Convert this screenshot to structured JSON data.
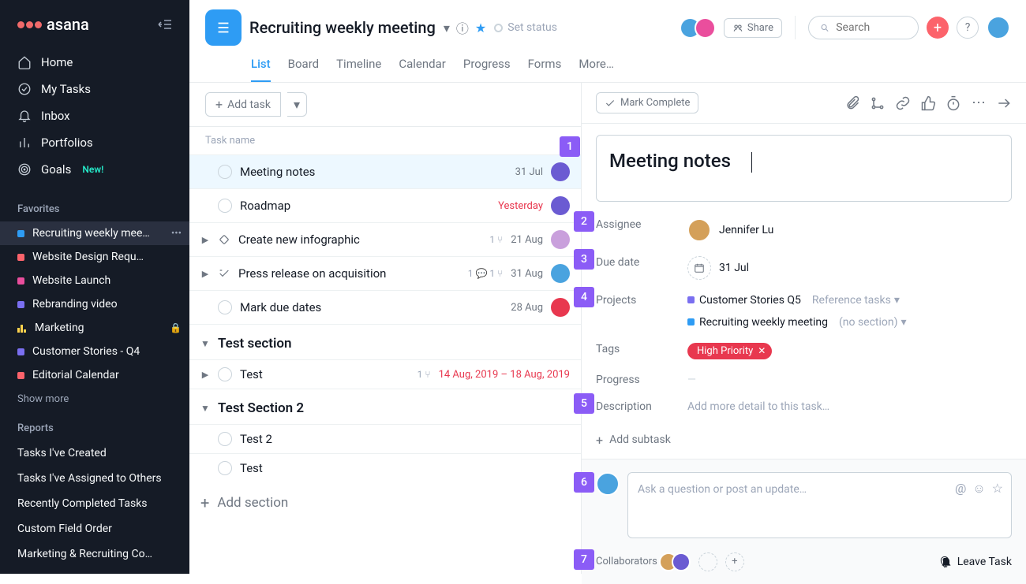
{
  "brand": "asana",
  "nav": [
    {
      "icon": "home",
      "label": "Home"
    },
    {
      "icon": "check",
      "label": "My Tasks"
    },
    {
      "icon": "bell",
      "label": "Inbox"
    },
    {
      "icon": "bars",
      "label": "Portfolios"
    },
    {
      "icon": "target",
      "label": "Goals",
      "badge": "New!"
    }
  ],
  "sections": {
    "favorites_header": "Favorites",
    "reports_header": "Reports",
    "show_more": "Show more"
  },
  "favorites": [
    {
      "color": "#2e9cf4",
      "label": "Recruiting weekly mee…",
      "active": true,
      "dots": true
    },
    {
      "color": "#fc636b",
      "label": "Website Design Requ…"
    },
    {
      "color": "#ea4e9d",
      "label": "Website Launch"
    },
    {
      "color": "#7a6ff0",
      "label": "Rebranding video"
    },
    {
      "bars": true,
      "label": "Marketing",
      "lock": true
    },
    {
      "color": "#7a6ff0",
      "label": "Customer Stories - Q4"
    },
    {
      "color": "#fc636b",
      "label": "Editorial Calendar"
    }
  ],
  "reports": [
    "Tasks I've Created",
    "Tasks I've Assigned to Others",
    "Recently Completed Tasks",
    "Custom Field Order",
    "Marketing & Recruiting Co…"
  ],
  "project": {
    "title": "Recruiting weekly meeting",
    "set_status": "Set status",
    "share": "Share",
    "search_placeholder": "Search"
  },
  "tabs": [
    "List",
    "Board",
    "Timeline",
    "Calendar",
    "Progress",
    "Forms",
    "More…"
  ],
  "active_tab": "List",
  "toolbar": {
    "add_task": "Add task"
  },
  "columns": {
    "task_name": "Task name"
  },
  "tasks_top": [
    {
      "name": "Meeting notes",
      "due": "31 Jul",
      "avatar": "#6b5bd2",
      "selected": true
    },
    {
      "name": "Roadmap",
      "due": "Yesterday",
      "due_red": true,
      "avatar": "#6b5bd2"
    },
    {
      "name": "Create new infographic",
      "due": "21 Aug",
      "avatar": "#c9a0dc",
      "caret": true,
      "milestone": true,
      "meta": "1 ⑂"
    },
    {
      "name": "Press release on acquisition",
      "due": "31 Aug",
      "avatar": "#4aa3df",
      "caret": true,
      "approval": true,
      "meta": "1 💬  1 ⑂"
    },
    {
      "name": "Mark due dates",
      "due": "28 Aug",
      "avatar": "#e8384f"
    }
  ],
  "section1": {
    "title": "Test section",
    "tasks": [
      {
        "name": "Test",
        "caret": true,
        "meta": "1 ⑂",
        "due": "14 Aug, 2019 – 18 Aug, 2019",
        "due_red": true
      }
    ]
  },
  "section2": {
    "title": "Test Section 2",
    "tasks": [
      {
        "name": "Test 2"
      },
      {
        "name": "Test"
      }
    ]
  },
  "add_section": "Add section",
  "detail": {
    "mark_complete": "Mark Complete",
    "title": "Meeting notes",
    "labels": {
      "assignee": "Assignee",
      "due": "Due date",
      "projects": "Projects",
      "tags": "Tags",
      "progress": "Progress",
      "description": "Description"
    },
    "assignee_name": "Jennifer Lu",
    "due_date": "31 Jul",
    "projects": [
      {
        "color": "#7a6ff0",
        "name": "Customer Stories Q5",
        "section": "Reference tasks"
      },
      {
        "color": "#2e9cf4",
        "name": "Recruiting weekly meeting",
        "section": "(no section)"
      }
    ],
    "tag": "High Priority",
    "progress": "—",
    "desc_placeholder": "Add more detail to this task…",
    "add_subtask": "Add subtask",
    "comment_placeholder": "Ask a question or post an update…",
    "collaborators": "Collaborators",
    "leave_task": "Leave Task"
  },
  "annotations": [
    "1",
    "2",
    "3",
    "4",
    "5",
    "6",
    "7"
  ]
}
